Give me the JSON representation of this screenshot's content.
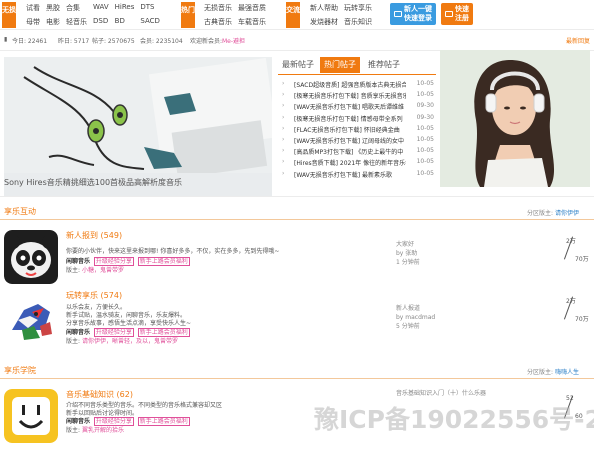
{
  "nav": {
    "groups": [
      {
        "badge": "无损",
        "color": "#f07a10",
        "links": [
          "试看",
          "母带",
          "黑胶",
          "电影",
          "合集",
          "轻音乐",
          "WAV",
          "DSD",
          "HiRes",
          "BD",
          "DTS",
          "SACD"
        ]
      },
      {
        "badge": "热门",
        "color": "#f07a10",
        "links": [
          "无损音乐",
          "最强音质",
          "古典音乐",
          "车载音乐"
        ]
      },
      {
        "badge": "交流",
        "color": "#f07a10",
        "links": [
          "新人帮助",
          "玩转享乐",
          "发烧器材",
          "音乐知识"
        ]
      }
    ],
    "buttons": [
      {
        "label": "新人一键\n快速登录",
        "color": "#3a9be0"
      },
      {
        "label": "快速\n注册",
        "color": "#f07a10"
      }
    ]
  },
  "stats": {
    "today": "今日: 22461",
    "yesterday": "昨日: 5717",
    "posts": "帖子: 2570675",
    "members": "会员: 2235104",
    "welcome_prefix": "欢迎新会员:",
    "new_member": "Me-避担",
    "latest_link": "最新回复"
  },
  "slider": {
    "caption": "Sony Hires音乐精挑细选100首极品高解析度音乐",
    "dots": 5,
    "active_dot": 1
  },
  "tabs": [
    "最新帖子",
    "热门帖子",
    "推荐帖子"
  ],
  "active_tab": 1,
  "posts": [
    {
      "title": "[SACD超级音质] 超强音质版本古典无损合集",
      "date": "10-05"
    },
    {
      "title": "[极寒无损音乐打包下载] 音质享乐无损音乐",
      "date": "10-05"
    },
    {
      "title": "[WAV无损音乐打包下载] 唱歌天后谭维维",
      "date": "09-30"
    },
    {
      "title": "[极寒无损音乐打包下载] 情感母带全系列",
      "date": "09-30"
    },
    {
      "title": "[FLAC无损音乐打包下载] 怀旧经典金曲",
      "date": "10-05"
    },
    {
      "title": "[WAV无损音乐打包下载] 辽阔母线的女中",
      "date": "10-05"
    },
    {
      "title": "[高品质MP3打包下载] 《历史上最牛的中",
      "date": "10-05"
    },
    {
      "title": "[Hires音质下载] 2021年 像往的新年音乐会",
      "date": "10-05"
    },
    {
      "title": "[WAV无损音乐打包下载] 最新素乐歌",
      "date": "10-05"
    }
  ],
  "section1": {
    "title": "享乐互动",
    "meta_prefix": "分区版主:",
    "moderator": "请你伊伊"
  },
  "forums": [
    {
      "name": "新人报到",
      "count": "(549)",
      "desc": [
        "你要的小伙伴，快来这里来报到哪! 你喜好多多，不仅，实在多多，先到先得哦~"
      ],
      "links_label": "闲聊音乐",
      "link1": "升级经验分享",
      "link2": "新手上路会员福利",
      "mods_label": "版主:",
      "mods": "小糖，鬼曾带罗",
      "last": [
        "大家好",
        "by 张助",
        "1 分钟前"
      ],
      "cnt1": "2万",
      "cnt2": "70万"
    },
    {
      "name": "玩转享乐",
      "count": "(574)",
      "desc": [
        "以乐会友，方便长久。",
        "新手试贴，温水骑友，闲聊音乐，乐友爆料。",
        "分享音乐故事，感悟生活点滴，享受快乐人生~"
      ],
      "links_label": "闲聊音乐",
      "link1": "升级经验分享",
      "link2": "新手上路会员福利",
      "mods_label": "版主:",
      "mods": "请你伊伊，晰曾轻，及以，鬼曾带罗",
      "last": [
        "新人报道",
        "by macdmad",
        "5 分钟前"
      ],
      "cnt1": "2万",
      "cnt2": "70万"
    },
    {
      "name": "音乐基础知识",
      "count": "(62)",
      "desc": [
        "介绍不同音乐类型的音乐。不同类型的音乐格式兼容却又区",
        "新手以回贴后讨论得时间。"
      ],
      "links_label": "闲聊音乐",
      "link1": "升级经验分享",
      "link2": "新手上路会员福利",
      "mods_label": "版主:",
      "mods": "翼乳开解的拾乐",
      "last": [
        "音乐基础知识入门（十）什么乐器"
      ],
      "cnt1": "52",
      "cnt2": "60"
    }
  ],
  "section2": {
    "title": "享乐学院",
    "meta_prefix": "分区版主:",
    "moderator": "嗨嗨人生"
  },
  "watermark": "豫ICP备19022556号-2"
}
